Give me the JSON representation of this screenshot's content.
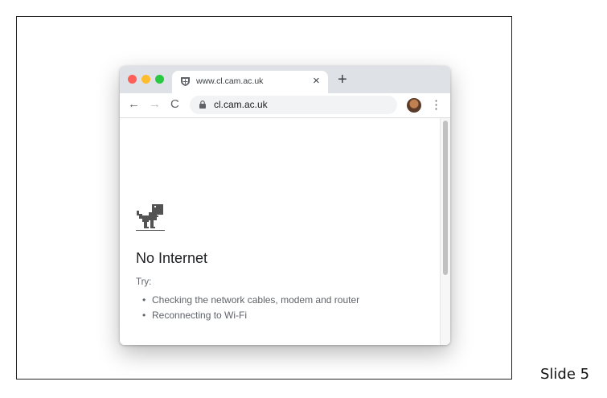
{
  "browser": {
    "tab": {
      "title": "www.cl.cam.ac.uk",
      "close_glyph": "×",
      "favicon": "shield-icon"
    },
    "new_tab_glyph": "+",
    "toolbar": {
      "back_glyph": "←",
      "forward_glyph": "→",
      "reload_glyph": "C",
      "url": "cl.cam.ac.uk",
      "star_glyph": "☆",
      "menu_glyph": "⋮"
    }
  },
  "error_page": {
    "title": "No Internet",
    "try_label": "Try:",
    "suggestions": [
      "Checking the network cables, modem and router",
      "Reconnecting to Wi-Fi"
    ]
  },
  "slide": {
    "label": "Slide 5"
  },
  "colors": {
    "red": "#fe5f57",
    "yellow": "#febc2e",
    "green": "#28c840",
    "tabstrip": "#dee1e6"
  }
}
